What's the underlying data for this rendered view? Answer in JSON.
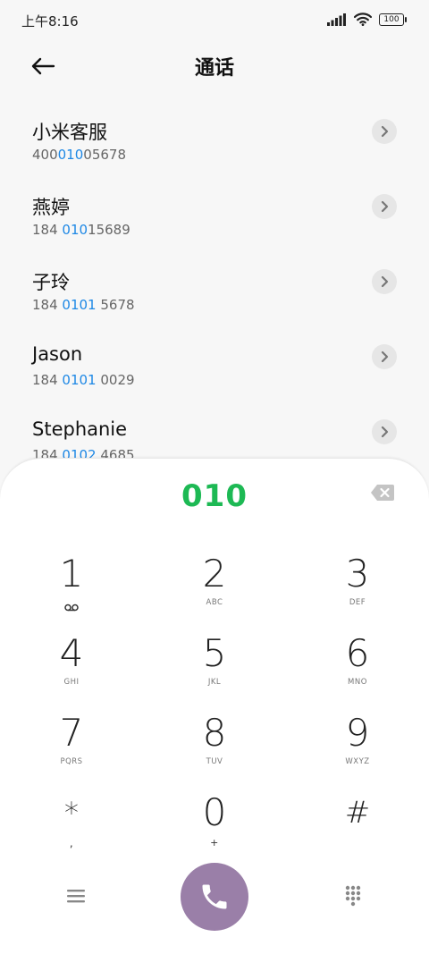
{
  "status_bar": {
    "time": "上午8:16",
    "battery": "100"
  },
  "header": {
    "title": "通话"
  },
  "contacts": [
    {
      "name": "小米客服",
      "number_parts": [
        "400",
        "010",
        "05678"
      ]
    },
    {
      "name": "燕婷",
      "number_parts": [
        "184 ",
        "010",
        "15689"
      ]
    },
    {
      "name": "子玲",
      "number_parts": [
        "184 ",
        "0101",
        " 5678"
      ]
    },
    {
      "name": "Jason",
      "number_parts": [
        "184 ",
        "0101",
        " 0029"
      ]
    },
    {
      "name": "Stephanie",
      "number_parts": [
        "184 ",
        "0102",
        " 4685"
      ]
    }
  ],
  "dialpad": {
    "dialed_number": "010",
    "keys": [
      {
        "digit": "1",
        "letters": ""
      },
      {
        "digit": "2",
        "letters": "ABC"
      },
      {
        "digit": "3",
        "letters": "DEF"
      },
      {
        "digit": "4",
        "letters": "GHI"
      },
      {
        "digit": "5",
        "letters": "JKL"
      },
      {
        "digit": "6",
        "letters": "MNO"
      },
      {
        "digit": "7",
        "letters": "PQRS"
      },
      {
        "digit": "8",
        "letters": "TUV"
      },
      {
        "digit": "9",
        "letters": "WXYZ"
      },
      {
        "digit": "*",
        "letters": ","
      },
      {
        "digit": "0",
        "letters": "+"
      },
      {
        "digit": "#",
        "letters": ""
      }
    ]
  },
  "colors": {
    "highlight": "#1e88e5",
    "dialed_number": "#1db954",
    "call_button": "#9a7fa8"
  }
}
